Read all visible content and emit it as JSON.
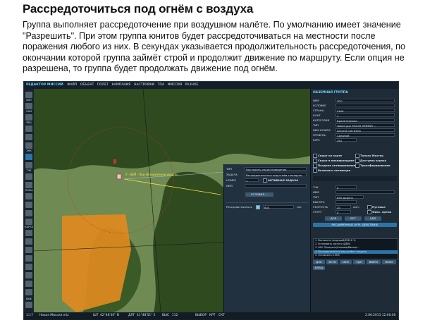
{
  "article": {
    "title": "Рассредоточиться под огнём с воздуха",
    "paragraph": "Группа выполняет рассредоточение при воздушном налёте. По умолчанию имеет значение \"Разрешить\". При этом группа юнитов будет рассредоточиваться на местности после поражения любого из них. В секундах указывается продолжительность рассредоточения, по окончании которой группа займёт строй и продолжит движение по маршруту. Если опция не разрешена, то группа будет продолжать движение под огнём."
  },
  "app": {
    "name": "РЕДАКТОР МИССИЙ",
    "menu": [
      "ФАЙЛ",
      "ОБЪЕКТ",
      "ПОЛЕТ",
      "КАМПАНИЯ",
      "НАСТРОЙКИ",
      "ТОА",
      "МИССИЯ",
      "РАЗНОЕ"
    ]
  },
  "toolbar": {
    "labels": [
      "ВЗЛ",
      "САМ",
      "РВЦ",
      "ЗНК",
      "ТЧК",
      "ЗОНЫ",
      "КАРТА",
      "ВЫХ"
    ]
  },
  "map": {
    "waypoint_label": "0 - ДЕЙ - При обнаружении укрыть",
    "colors": {
      "forest": "#2f4a1f",
      "field": "#6f8a53",
      "zone": "#e08a1f",
      "route": "#ffe14a"
    }
  },
  "waypoint_panel": {
    "rows": [
      {
        "label": "ТИП",
        "value": "Настроить опции поведения"
      },
      {
        "label": "ЗАДАЧА",
        "value": "Рассредоточиться под огнём с воздуха"
      },
      {
        "label": "НОМЕР",
        "value": "1"
      },
      {
        "label": "ИМЯ",
        "value": ""
      }
    ],
    "active_task_label": "АКТИВНАЯ ЗАДАЧА",
    "condition_button": "УСЛОВИЯ ...",
    "option_label": "Рассредоточиться",
    "option_value": "600",
    "option_unit": "сек"
  },
  "group_panel": {
    "title": "НАЗЕМНАЯ ГРУППА",
    "rows": [
      {
        "label": "ИМЯ",
        "value": "ПЗС"
      },
      {
        "label": "УСЛОВИЕ",
        "value": ""
      },
      {
        "label": "СТРАНА",
        "value": "США"
      },
      {
        "label": "КОНТ",
        "value": "1"
      },
      {
        "label": "КАТЕГОРИЯ",
        "value": "Бронетехника"
      },
      {
        "label": "ТИП",
        "value": "Towed gun M1045 HMMWV ..."
      },
      {
        "label": "ИМЯ ЮНИТА",
        "value": "Ground unit #001"
      },
      {
        "label": "УРОВЕНЬ",
        "value": "Средний"
      },
      {
        "label": "КУРС",
        "value": "261"
      }
    ],
    "checks_left": [
      "Скрыт на карте",
      "Скрыт в планировщике",
      "Позднее активирование",
      "Включить активация"
    ],
    "checks_right": [
      "Только Мастер",
      "Доступно игроку",
      "Трансферирование"
    ],
    "route_rows": [
      {
        "label": "ТЧК",
        "value": "0"
      },
      {
        "label": "ИМЯ",
        "value": ""
      },
      {
        "label": "ТИП",
        "value": "Вне дороги"
      },
      {
        "label": "ВЫСОТА",
        "value": ""
      },
      {
        "label": "СКОРОСТЬ",
        "value": "20"
      },
      {
        "label": "СТАРТ",
        "value": "0"
      }
    ],
    "speed_unit": "км/ч",
    "right_options": [
      "Путевые",
      "Фикс. время"
    ],
    "buttons_a": [
      "ДОБ",
      "ВСТ",
      "УДЛ"
    ],
    "advanced_button": "РАСШИРЕННЫЕ (УПР. ДЕЙСТВИЯ)",
    "actions": [
      "1. Исключить (ведущий/ВЗМ-К 1)",
      "2. Установить частоту (ДБМ)",
      "3. ЗАХ. Прикрыть/Атакова/Маскир...",
      "4. Рассредоточиться под огнём с воздуха",
      "5. Отключить в ЛНК"
    ],
    "buttons_b": [
      "ДОБ",
      "ВСТВ",
      "ИЗМ",
      "УДЛ",
      "ВВЕРХ",
      "ВНИЗ"
    ],
    "save_button": "ВЛЕЩ"
  },
  "status": {
    "zoom": "1:17",
    "mission_file": "Новая Миссия.miz",
    "lat_label": "ШТ",
    "lat": "42°48'30\" N",
    "lon_label": "ДЛГ",
    "lon": "41°48'51\" E",
    "alt_label": "ВЫС",
    "alt": "112",
    "tools": [
      "ВЫБОР",
      "КРТ",
      "СКТ"
    ],
    "datetime": "2.06.2013 12:00:00"
  }
}
